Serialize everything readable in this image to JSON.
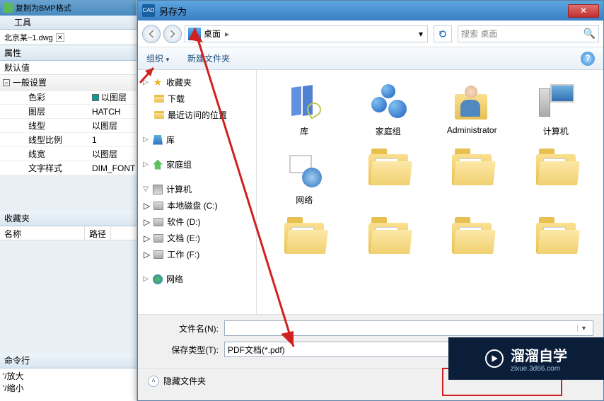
{
  "leftPane": {
    "titlebar_hint": "复制为BMP格式",
    "menu_tool": "工具",
    "file_tab": "北京某~1.dwg",
    "prop_header": "属性",
    "prop_default": "默认值",
    "section_general": "一般设置",
    "rows": [
      {
        "k": "色彩",
        "v": "以图层",
        "swatch": true
      },
      {
        "k": "图层",
        "v": "HATCH"
      },
      {
        "k": "线型",
        "v": "以图层"
      },
      {
        "k": "线型比例",
        "v": "1"
      },
      {
        "k": "线宽",
        "v": "以图层"
      },
      {
        "k": "文字样式",
        "v": "DIM_FONT"
      }
    ],
    "fav_header": "收藏夹",
    "col_name": "名称",
    "col_path": "路径",
    "cmd_header": "命令行",
    "cmd_lines": [
      "'/放大",
      "'/缩小"
    ]
  },
  "dialog": {
    "title": "另存为",
    "close_x": "✕",
    "location": "桌面",
    "search_placeholder": "搜索 桌面",
    "organize": "组织",
    "new_folder": "新建文件夹",
    "tree": {
      "favorites": "收藏夹",
      "downloads": "下载",
      "recent": "最近访问的位置",
      "library": "库",
      "homegroup": "家庭组",
      "computer": "计算机",
      "disk_c": "本地磁盘 (C:)",
      "disk_d": "软件 (D:)",
      "disk_e": "文档 (E:)",
      "disk_f": "工作 (F:)",
      "network": "网络"
    },
    "items": [
      {
        "label": "库",
        "type": "lib"
      },
      {
        "label": "家庭组",
        "type": "home"
      },
      {
        "label": "Administrator",
        "type": "user"
      },
      {
        "label": "计算机",
        "type": "pc"
      },
      {
        "label": "网络",
        "type": "net"
      },
      {
        "label": "",
        "type": "folder"
      },
      {
        "label": "",
        "type": "folder"
      },
      {
        "label": "",
        "type": "folder"
      },
      {
        "label": "",
        "type": "folder"
      },
      {
        "label": "",
        "type": "folder"
      },
      {
        "label": "",
        "type": "folder"
      },
      {
        "label": "",
        "type": "folder"
      }
    ],
    "filename_label": "文件名(N):",
    "filename_value": "",
    "filetype_label": "保存类型(T):",
    "filetype_value": "PDF文档(*.pdf)",
    "hide_folders": "隐藏文件夹"
  },
  "watermark": {
    "main": "溜溜自学",
    "sub": "zixue.3d66.com"
  }
}
